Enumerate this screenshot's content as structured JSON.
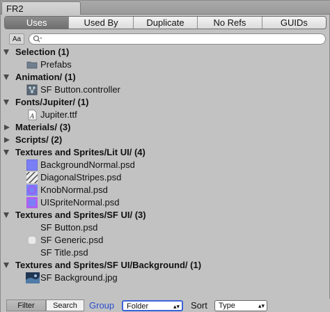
{
  "window": {
    "title": "FR2"
  },
  "tabs": [
    {
      "label": "Uses",
      "active": true
    },
    {
      "label": "Used By",
      "active": false
    },
    {
      "label": "Duplicate",
      "active": false
    },
    {
      "label": "No Refs",
      "active": false
    },
    {
      "label": "GUIDs",
      "active": false
    }
  ],
  "search": {
    "case_toggle_label": "Aa",
    "value": ""
  },
  "tree": [
    {
      "kind": "group",
      "expanded": true,
      "label": "Selection (1)"
    },
    {
      "kind": "item",
      "icon": "folder-icon",
      "label": "Prefabs"
    },
    {
      "kind": "group",
      "expanded": true,
      "label": "Animation/ (1)"
    },
    {
      "kind": "item",
      "icon": "animator-controller-icon",
      "label": "SF Button.controller"
    },
    {
      "kind": "group",
      "expanded": true,
      "label": "Fonts/Jupiter/ (1)"
    },
    {
      "kind": "item",
      "icon": "font-file-icon",
      "label": "Jupiter.ttf"
    },
    {
      "kind": "group",
      "expanded": false,
      "label": "Materials/ (3)"
    },
    {
      "kind": "group",
      "expanded": false,
      "label": "Scripts/ (2)"
    },
    {
      "kind": "group",
      "expanded": true,
      "label": "Textures and Sprites/Lit UI/ (4)"
    },
    {
      "kind": "item",
      "icon": "texture-blue-icon",
      "label": "BackgroundNormal.psd"
    },
    {
      "kind": "item",
      "icon": "texture-stripes-icon",
      "label": "DiagonalStripes.psd"
    },
    {
      "kind": "item",
      "icon": "texture-knob-icon",
      "label": "KnobNormal.psd"
    },
    {
      "kind": "item",
      "icon": "texture-sprite-icon",
      "label": "UISpriteNormal.psd"
    },
    {
      "kind": "group",
      "expanded": true,
      "label": "Textures and Sprites/SF UI/ (3)"
    },
    {
      "kind": "item",
      "icon": "blank-sprite-icon",
      "label": "SF Button.psd"
    },
    {
      "kind": "item",
      "icon": "rounded-sprite-icon",
      "label": "SF Generic.psd"
    },
    {
      "kind": "item",
      "icon": "blank-sprite-icon",
      "label": "SF Title.psd"
    },
    {
      "kind": "group",
      "expanded": true,
      "label": "Textures and Sprites/SF UI/Background/ (1)"
    },
    {
      "kind": "item",
      "icon": "background-image-icon",
      "label": "SF Background.jpg"
    }
  ],
  "bottombar": {
    "filter_label": "Filter",
    "search_label": "Search",
    "group_label": "Group",
    "group_value": "Folder",
    "sort_label": "Sort",
    "sort_value": "Type"
  },
  "colors": {
    "panel_bg": "#c2c2c2",
    "active_tab": "#7a7a7a",
    "accent_blue": "#2a4fd0"
  }
}
